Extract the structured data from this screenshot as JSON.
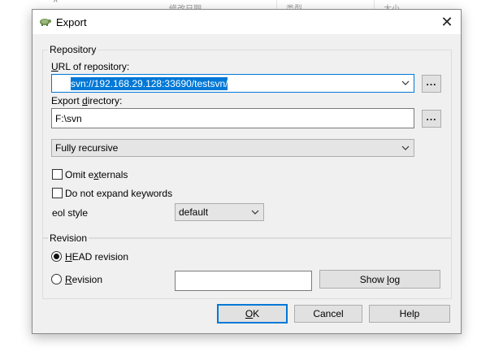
{
  "background_window": {
    "columns": [
      "修改日期",
      "类型",
      "大小"
    ]
  },
  "dialog": {
    "title": "Export",
    "close_glyph": "✕"
  },
  "repository": {
    "group_label": "Repository",
    "url_label_prefix": "",
    "url_label_underlined": "U",
    "url_label_rest": "RL of repository:",
    "url_value": "svn://192.168.29.128:33690/testsvn/",
    "export_label_prefix": "Export ",
    "export_label_underlined": "d",
    "export_label_rest": "irectory:",
    "export_value": "F:\\svn",
    "browse_label": "...",
    "depth_value": "Fully recursive",
    "omit_prefix": "Omit e",
    "omit_underlined": "x",
    "omit_rest": "ternals",
    "noexpand_label": "Do not expand keywords",
    "eol_label": "eol style",
    "eol_value": "default"
  },
  "revision": {
    "group_label": "Revision",
    "head_underlined": "H",
    "head_rest": "EAD revision",
    "rev_underlined": "R",
    "rev_rest": "evision",
    "rev_value": "",
    "showlog_prefix": "Show ",
    "showlog_underlined": "l",
    "showlog_rest": "og"
  },
  "buttons": {
    "ok_underlined": "O",
    "ok_rest": "K",
    "cancel": "Cancel",
    "help": "Help"
  },
  "icons": {
    "app": "tortoise-icon",
    "close": "close-icon",
    "chevron": "chevron-down-icon"
  }
}
